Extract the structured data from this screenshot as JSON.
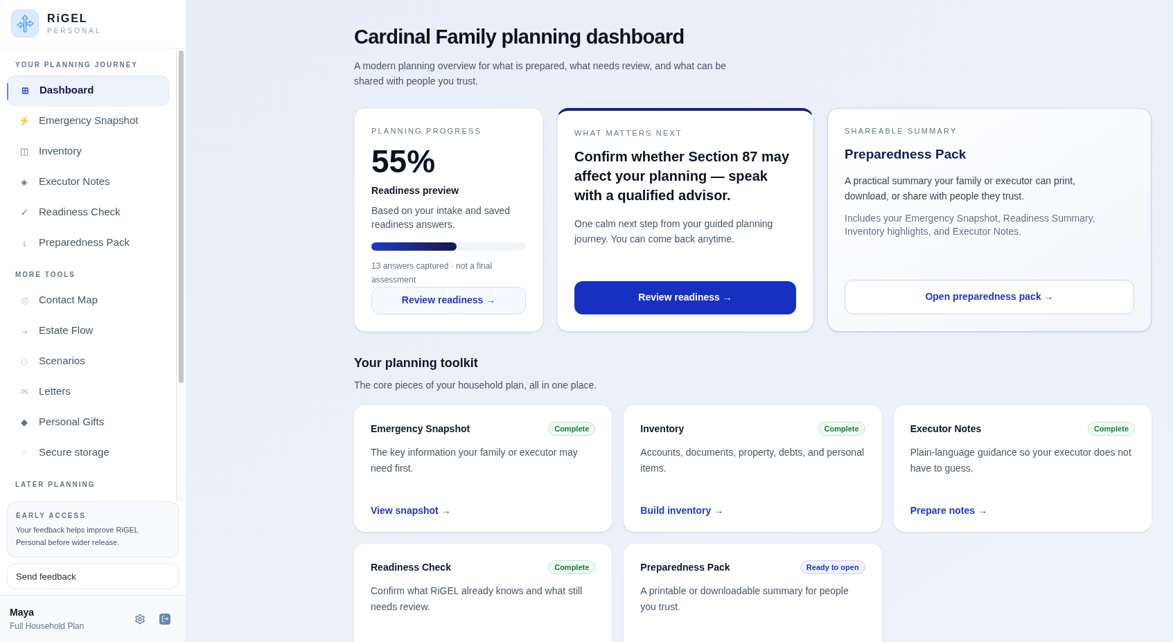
{
  "brand": {
    "name": "RiGEL",
    "tagline": "PERSONAL"
  },
  "sidebar": {
    "sections": [
      {
        "heading": "YOUR PLANNING JOURNEY",
        "items": [
          {
            "icon": "⊞",
            "label": "Dashboard",
            "selected": true,
            "kind": "grid"
          },
          {
            "icon": "⚡",
            "label": "Emergency Snapshot",
            "selected": false,
            "kind": "bolt"
          },
          {
            "icon": "◫",
            "label": "Inventory",
            "selected": false,
            "kind": "plain"
          },
          {
            "icon": "◈",
            "label": "Executor Notes",
            "selected": false,
            "kind": "plain"
          },
          {
            "icon": "✓",
            "label": "Readiness Check",
            "selected": false,
            "kind": "plain"
          },
          {
            "icon": "↓",
            "label": "Preparedness Pack",
            "selected": false,
            "kind": "plain"
          }
        ]
      },
      {
        "heading": "MORE TOOLS",
        "items": [
          {
            "icon": "◎",
            "label": "Contact Map",
            "selected": false,
            "kind": "light"
          },
          {
            "icon": "→",
            "label": "Estate Flow",
            "selected": false,
            "kind": "plain"
          },
          {
            "icon": "◇",
            "label": "Scenarios",
            "selected": false,
            "kind": "light"
          },
          {
            "icon": "✉",
            "label": "Letters",
            "selected": false,
            "kind": "light"
          },
          {
            "icon": "◆",
            "label": "Personal Gifts",
            "selected": false,
            "kind": "plain"
          },
          {
            "icon": "○",
            "label": "Secure storage",
            "selected": false,
            "kind": "light"
          }
        ]
      },
      {
        "heading": "LATER PLANNING"
      }
    ],
    "early_access": {
      "label": "EARLY ACCESS",
      "text": "Your feedback helps improve RiGEL Personal before wider release."
    },
    "feedback_button": "Send feedback",
    "user": {
      "name": "Maya",
      "plan": "Full Household Plan"
    }
  },
  "header": {
    "title": "Cardinal Family planning dashboard",
    "subtitle": "A modern planning overview for what is prepared, what needs review, and what can be shared with people you trust."
  },
  "progress_card": {
    "label": "PLANNING PROGRESS",
    "percent": "55%",
    "title": "Readiness preview",
    "text": "Based on your intake and saved readiness answers.",
    "level": 0.55,
    "note": "13 answers captured · not a final assessment",
    "button": "Review readiness →"
  },
  "next_card": {
    "label": "WHAT MATTERS NEXT",
    "title": "Confirm whether Section 87 may affect your planning — speak with a qualified advisor.",
    "text": "One calm next step from your guided planning journey. You can come back anytime.",
    "button": "Review readiness →"
  },
  "summary_card": {
    "label": "SHAREABLE SUMMARY",
    "title": "Preparedness Pack",
    "text": "A practical summary your family or executor can print, download, or share with people they trust.",
    "note": "Includes your Emergency Snapshot, Readiness Summary, Inventory highlights, and Executor Notes.",
    "button": "Open preparedness pack →"
  },
  "toolkit": {
    "title": "Your planning toolkit",
    "subtitle": "The core pieces of your household plan, all in one place.",
    "cards": [
      {
        "title": "Emergency Snapshot",
        "status": "Complete",
        "kind": "complete",
        "text": "The key information your family or executor may need first.",
        "link": "View snapshot →"
      },
      {
        "title": "Inventory",
        "status": "Complete",
        "kind": "complete",
        "text": "Accounts, documents, property, debts, and personal items.",
        "link": "Build inventory →"
      },
      {
        "title": "Executor Notes",
        "status": "Complete",
        "kind": "complete",
        "text": "Plain-language guidance so your executor does not have to guess.",
        "link": "Prepare notes →"
      },
      {
        "title": "Readiness Check",
        "status": "Complete",
        "kind": "complete",
        "text": "Confirm what RiGEL already knows and what still needs review."
      },
      {
        "title": "Preparedness Pack",
        "status": "Ready to open",
        "kind": "ready",
        "text": "A printable or downloadable summary for people you trust."
      }
    ]
  }
}
